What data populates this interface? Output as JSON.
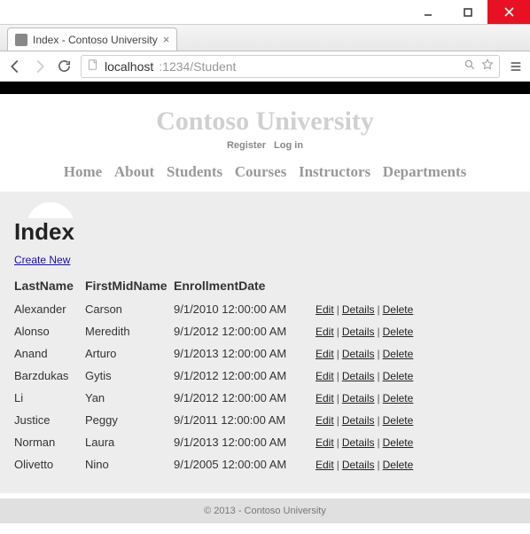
{
  "window": {
    "tab_title": "Index - Contoso University"
  },
  "address_bar": {
    "host": "localhost",
    "port_path": ":1234/Student"
  },
  "banner": {
    "title": "Contoso University",
    "register": "Register",
    "login": "Log in"
  },
  "nav": {
    "items": [
      {
        "label": "Home"
      },
      {
        "label": "About"
      },
      {
        "label": "Students"
      },
      {
        "label": "Courses"
      },
      {
        "label": "Instructors"
      },
      {
        "label": "Departments"
      }
    ]
  },
  "main": {
    "heading": "Index",
    "create_label": "Create New",
    "columns": {
      "last": "LastName",
      "first": "FirstMidName",
      "date": "EnrollmentDate"
    },
    "actions": {
      "edit": "Edit",
      "details": "Details",
      "delete": "Delete"
    },
    "rows": [
      {
        "last": "Alexander",
        "first": "Carson",
        "date": "9/1/2010 12:00:00 AM"
      },
      {
        "last": "Alonso",
        "first": "Meredith",
        "date": "9/1/2012 12:00:00 AM"
      },
      {
        "last": "Anand",
        "first": "Arturo",
        "date": "9/1/2013 12:00:00 AM"
      },
      {
        "last": "Barzdukas",
        "first": "Gytis",
        "date": "9/1/2012 12:00:00 AM"
      },
      {
        "last": "Li",
        "first": "Yan",
        "date": "9/1/2012 12:00:00 AM"
      },
      {
        "last": "Justice",
        "first": "Peggy",
        "date": "9/1/2011 12:00:00 AM"
      },
      {
        "last": "Norman",
        "first": "Laura",
        "date": "9/1/2013 12:00:00 AM"
      },
      {
        "last": "Olivetto",
        "first": "Nino",
        "date": "9/1/2005 12:00:00 AM"
      }
    ]
  },
  "footer": {
    "text": "© 2013 - Contoso University"
  }
}
